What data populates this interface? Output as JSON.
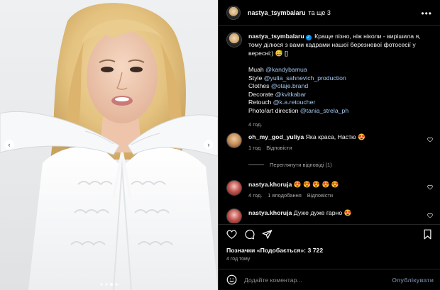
{
  "header": {
    "username": "nastya_tsymbalaru",
    "with_text": "та ще 3",
    "more_label": "•••"
  },
  "caption": {
    "username": "nastya_tsymbalaru",
    "verified_mark": "✓",
    "text": "Краще пізно, ніж ніколи - вирішила я, тому ділюся з вами кадрами нашої березневої фотосесії у вересні:) 😅 []",
    "credits": [
      {
        "role": "Muah ",
        "handle": "@kandybamua"
      },
      {
        "role": "Style ",
        "handle": "@yulia_sahnevich_production"
      },
      {
        "role": "Clothes ",
        "handle": "@otaje.brand"
      },
      {
        "role": "Decorate ",
        "handle": "@kvitkabar"
      },
      {
        "role": "Retouch ",
        "handle": "@k.a.retoucher"
      },
      {
        "role": "Photo/art direction ",
        "handle": "@tania_strela_ph"
      }
    ],
    "time": "4 год."
  },
  "comments": [
    {
      "username": "oh_my_god_yuliya",
      "text": "Яка краса, Настю 😍",
      "time": "1 год",
      "reply_label": "Відповісти",
      "likes_label": ""
    },
    {
      "username": "nastya.khoruja",
      "text": "😍 😍 😍 😍 😍",
      "time": "4 год.",
      "likes_label": "1 вподобання",
      "reply_label": "Відповісти"
    },
    {
      "username": "nastya.khoruja",
      "text": "Дуже дуже гарно 😍",
      "time": "",
      "likes_label": "",
      "reply_label": ""
    }
  ],
  "view_replies_label": "Переглянути відповіді (1)",
  "likes": "Позначки «Подобається»: 3 722",
  "posted": "4 год тому",
  "composer": {
    "placeholder": "Додайте коментар...",
    "publish_label": "Опублікувати"
  },
  "carousel": {
    "prev_glyph": "‹",
    "next_glyph": "›",
    "slide_count": 4,
    "active_index": 2
  },
  "colors": {
    "background": "#000000",
    "text": "#f5f5f5",
    "secondary": "#a8a8a8",
    "mention": "#a5c8f0",
    "verified": "#0095f6",
    "divider": "#262626"
  }
}
